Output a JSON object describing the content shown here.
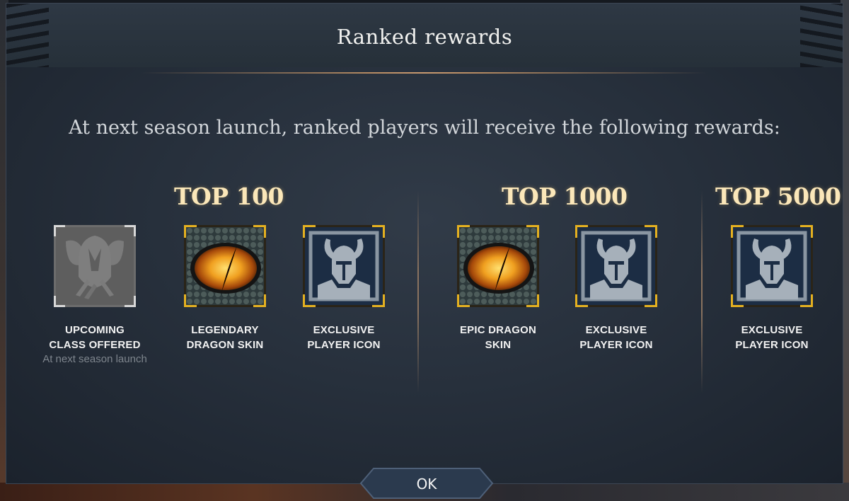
{
  "dialog": {
    "title": "Ranked rewards",
    "subtitle": "At next season launch, ranked players will receive the following rewards:"
  },
  "tiers": [
    {
      "label": "TOP 100"
    },
    {
      "label": "TOP 1000"
    },
    {
      "label": "TOP 5000"
    }
  ],
  "rewards": [
    {
      "line1": "UPCOMING",
      "line2": "CLASS OFFERED",
      "note": "At next season launch",
      "icon": "class-helmet-icon"
    },
    {
      "line1": "LEGENDARY",
      "line2": "DRAGON SKIN",
      "icon": "dragon-eye-icon"
    },
    {
      "line1": "EXCLUSIVE",
      "line2": "PLAYER ICON",
      "icon": "horned-helmet-icon"
    },
    {
      "line1": "EPIC DRAGON",
      "line2": "SKIN",
      "icon": "dragon-eye-icon"
    },
    {
      "line1": "EXCLUSIVE",
      "line2": "PLAYER ICON",
      "icon": "horned-helmet-icon"
    },
    {
      "line1": "EXCLUSIVE",
      "line2": "PLAYER ICON",
      "icon": "horned-helmet-icon"
    }
  ],
  "buttons": {
    "ok": "OK"
  },
  "colors": {
    "tier_text": "#fbe7b9",
    "frame_gold": "#e4b020",
    "frame_silver": "#d8d8d8",
    "dialog_bg": "#27303c"
  }
}
